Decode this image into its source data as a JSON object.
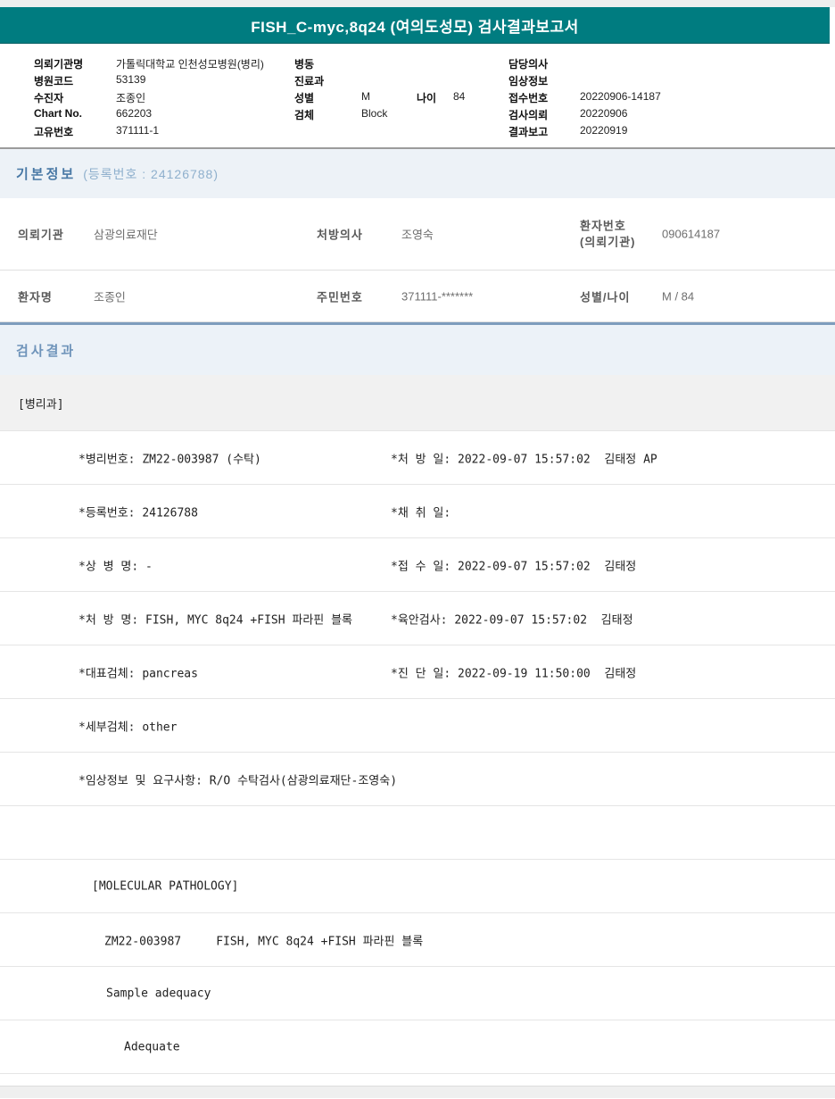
{
  "title": "FISH_C-myc,8q24 (여의도성모) 검사결과보고서",
  "patient_header": {
    "rows": [
      {
        "c1l": "의뢰기관명",
        "c1v": "가톨릭대학교 인천성모병원(병리)",
        "c2l": "병동",
        "c2v": "",
        "c3l": "담당의사",
        "c3v": ""
      },
      {
        "c1l": "병원코드",
        "c1v": "53139",
        "c2l": "진료과",
        "c2v": "",
        "c3l": "임상정보",
        "c3v": ""
      },
      {
        "c1l": "수진자",
        "c1v": "조종인",
        "c2l": "성별",
        "c2v": "M",
        "agel": "나이",
        "agev": "84",
        "c3l": "접수번호",
        "c3v": "20220906-14187"
      },
      {
        "c1l": "Chart No.",
        "c1v": "662203",
        "c2l": "검체",
        "c2v": "Block",
        "c3l": "검사의뢰",
        "c3v": "20220906"
      },
      {
        "c1l": "고유번호",
        "c1v": "371111-1",
        "c2l": "",
        "c2v": "",
        "c3l": "결과보고",
        "c3v": "20220919"
      }
    ]
  },
  "basic_info": {
    "section_title": "기본정보",
    "section_subtitle": "(등록번호 : 24126788)",
    "client_label": "의뢰기관",
    "client_value": "삼광의료재단",
    "doctor_label": "처방의사",
    "doctor_value": "조영숙",
    "patient_no_label1": "환자번호",
    "patient_no_label2": "(의뢰기관)",
    "patient_no_value": "090614187",
    "patient_name_label": "환자명",
    "patient_name_value": "조종인",
    "rrn_label": "주민번호",
    "rrn_value": "371111-*******",
    "sex_age_label": "성별/나이",
    "sex_age_value": "M / 84"
  },
  "results": {
    "section_title": "검사결과",
    "department": "[병리과]",
    "detail_rows": [
      {
        "left": "*병리번호: ZM22-003987 (수탁)",
        "right": "*처 방 일: 2022-09-07 15:57:02  김태정 AP"
      },
      {
        "left": "*등록번호: 24126788",
        "right": "*채 취 일:"
      },
      {
        "left": "*상 병 명: -",
        "right": "*접 수 일: 2022-09-07 15:57:02  김태정"
      },
      {
        "left": "*처 방 명: FISH, MYC 8q24 +FISH 파라핀 블록",
        "right": "*육안검사: 2022-09-07 15:57:02  김태정"
      },
      {
        "left": "*대표검체: pancreas",
        "right": "*진 단 일: 2022-09-19 11:50:00  김태정"
      },
      {
        "left": "*세부검체: other",
        "right": ""
      },
      {
        "left": "*임상정보 및 요구사항: R/O 수탁검사(삼광의료재단-조영숙)",
        "right": ""
      }
    ],
    "molecular_header": "[MOLECULAR PATHOLOGY]",
    "molecular_line": "ZM22-003987     FISH, MYC 8q24 +FISH 파라핀 블록",
    "sample_adequacy_label": "Sample adequacy",
    "sample_adequacy_value": "Adequate"
  }
}
